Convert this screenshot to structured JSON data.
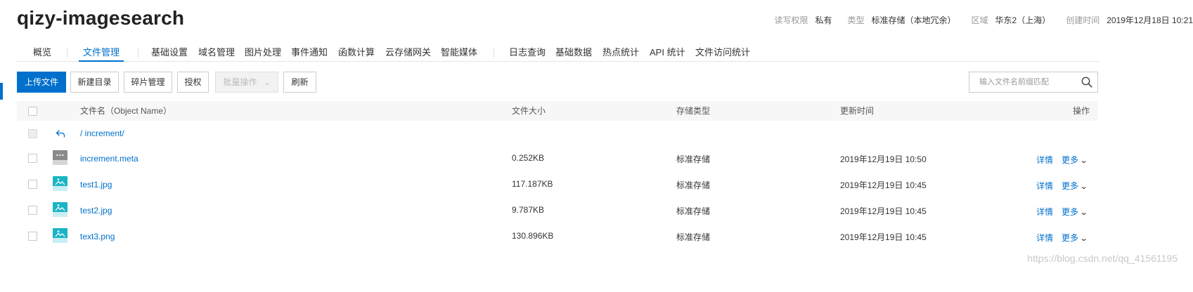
{
  "header": {
    "bucket_name": "qizy-imagesearch",
    "meta": [
      {
        "label": "读写权限",
        "value": "私有"
      },
      {
        "label": "类型",
        "value": "标准存储（本地冗余）"
      },
      {
        "label": "区域",
        "value": "华东2（上海）"
      },
      {
        "label": "创建时间",
        "value": "2019年12月18日 10:21"
      }
    ]
  },
  "tabs": [
    {
      "label": "概览"
    },
    {
      "label": "文件管理",
      "active": true
    },
    {
      "label": "基础设置"
    },
    {
      "label": "域名管理"
    },
    {
      "label": "图片处理"
    },
    {
      "label": "事件通知"
    },
    {
      "label": "函数计算"
    },
    {
      "label": "云存储网关"
    },
    {
      "label": "智能媒体"
    },
    {
      "label": "日志查询"
    },
    {
      "label": "基础数据"
    },
    {
      "label": "热点统计"
    },
    {
      "label": "API 统计"
    },
    {
      "label": "文件访问统计"
    }
  ],
  "toolbar": {
    "upload": "上传文件",
    "new_dir": "新建目录",
    "fragments": "碎片管理",
    "authorize": "授权",
    "batch": "批量操作",
    "refresh": "刷新"
  },
  "search": {
    "placeholder": "输入文件名前缀匹配"
  },
  "table": {
    "headers": {
      "name": "文件名（Object Name）",
      "size": "文件大小",
      "storage": "存储类型",
      "updated": "更新时间",
      "actions": "操作"
    },
    "path": "/ increment/",
    "rows": [
      {
        "name": "increment.meta",
        "icon": "generic-file-icon",
        "size": "0.252KB",
        "storage": "标准存储",
        "updated": "2019年12月19日 10:50",
        "detail": "详情",
        "more": "更多"
      },
      {
        "name": "test1.jpg",
        "icon": "image-file-icon",
        "size": "117.187KB",
        "storage": "标准存储",
        "updated": "2019年12月19日 10:45",
        "detail": "详情",
        "more": "更多"
      },
      {
        "name": "test2.jpg",
        "icon": "image-file-icon",
        "size": "9.787KB",
        "storage": "标准存储",
        "updated": "2019年12月19日 10:45",
        "detail": "详情",
        "more": "更多"
      },
      {
        "name": "text3.png",
        "icon": "image-file-icon",
        "size": "130.896KB",
        "storage": "标准存储",
        "updated": "2019年12月19日 10:45",
        "detail": "详情",
        "more": "更多"
      }
    ]
  },
  "watermark": "https://blog.csdn.net/qq_41561195",
  "colors": {
    "accent": "#0070cc",
    "image_icon": "#1ab5c4",
    "generic_icon": "#8a8a8a"
  }
}
